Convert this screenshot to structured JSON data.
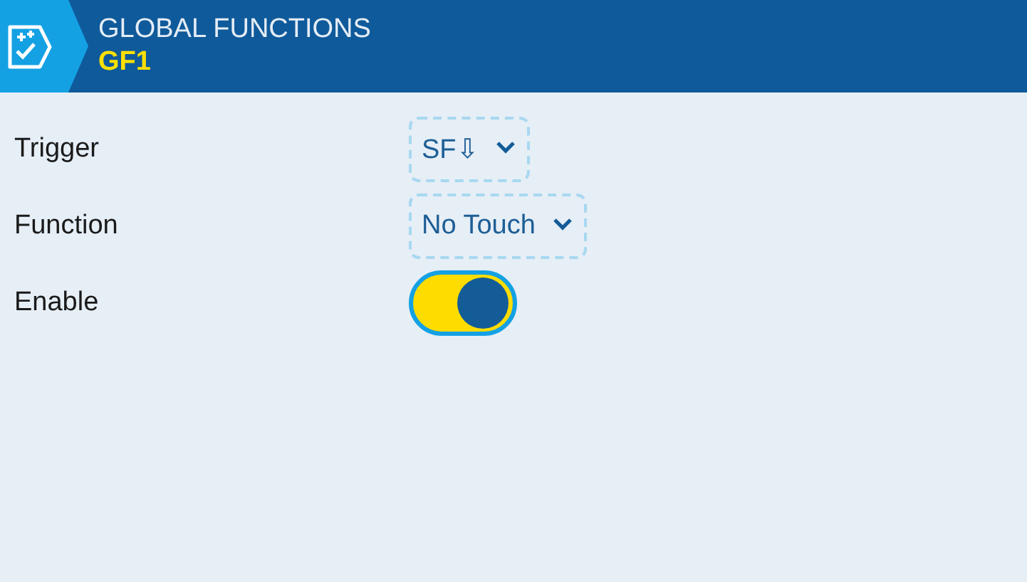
{
  "header": {
    "title": "GLOBAL FUNCTIONS",
    "subtitle": "GF1"
  },
  "fields": [
    {
      "kind": "dropdown",
      "label": "Trigger",
      "value": "SF⇩"
    },
    {
      "kind": "dropdown",
      "label": "Function",
      "value": "No Touch"
    },
    {
      "kind": "toggle",
      "label": "Enable",
      "on": true
    }
  ]
}
